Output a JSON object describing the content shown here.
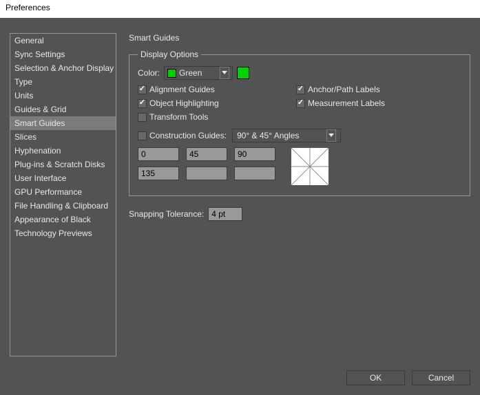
{
  "window": {
    "title": "Preferences"
  },
  "sidebar": {
    "items": [
      {
        "label": "General"
      },
      {
        "label": "Sync Settings"
      },
      {
        "label": "Selection & Anchor Display"
      },
      {
        "label": "Type"
      },
      {
        "label": "Units"
      },
      {
        "label": "Guides & Grid"
      },
      {
        "label": "Smart Guides"
      },
      {
        "label": "Slices"
      },
      {
        "label": "Hyphenation"
      },
      {
        "label": "Plug-ins & Scratch Disks"
      },
      {
        "label": "User Interface"
      },
      {
        "label": "GPU Performance"
      },
      {
        "label": "File Handling & Clipboard"
      },
      {
        "label": "Appearance of Black"
      },
      {
        "label": "Technology Previews"
      }
    ],
    "selected_index": 6
  },
  "panel": {
    "title": "Smart Guides",
    "display_options": {
      "legend": "Display Options",
      "color_label": "Color:",
      "color_name": "Green",
      "color_hex": "#00d000",
      "alignment_guides": {
        "label": "Alignment Guides",
        "checked": true
      },
      "anchor_path_labels": {
        "label": "Anchor/Path Labels",
        "checked": true
      },
      "object_highlighting": {
        "label": "Object Highlighting",
        "checked": true
      },
      "measurement_labels": {
        "label": "Measurement Labels",
        "checked": true
      },
      "transform_tools": {
        "label": "Transform Tools",
        "checked": false
      },
      "construction_guides": {
        "label": "Construction Guides:",
        "checked": false,
        "selected": "90° & 45° Angles",
        "angles": [
          "0",
          "45",
          "90",
          "135",
          "",
          ""
        ]
      }
    },
    "snapping": {
      "label": "Snapping Tolerance:",
      "value": "4 pt"
    }
  },
  "buttons": {
    "ok": "OK",
    "cancel": "Cancel"
  }
}
